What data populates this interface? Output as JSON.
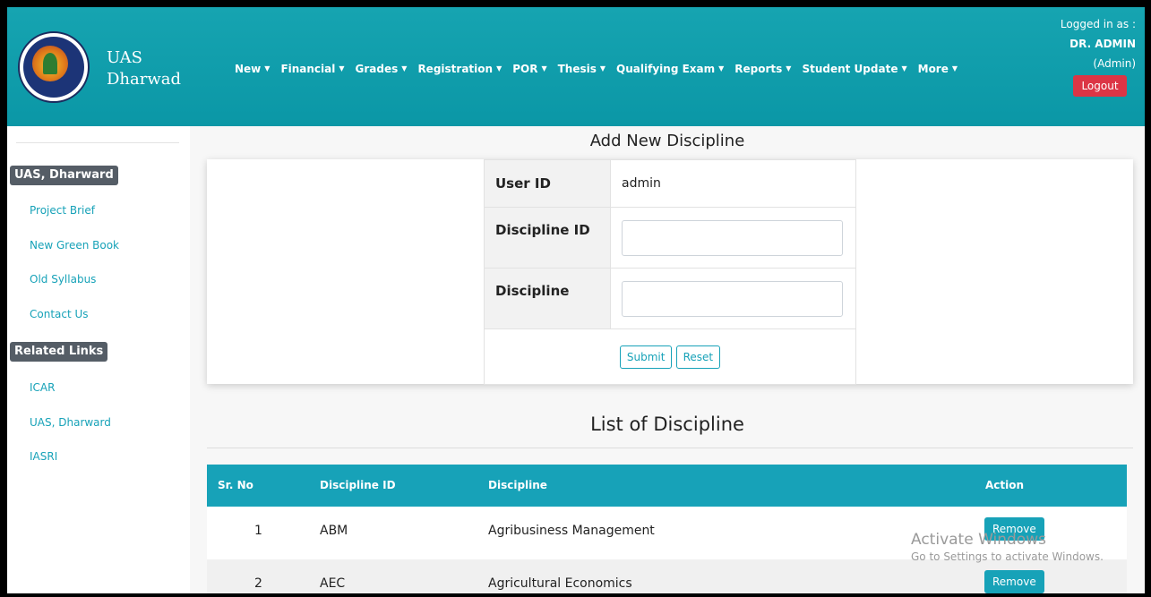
{
  "navbar": {
    "brand_line1": "UAS",
    "brand_line2": "Dharwad",
    "menu": [
      {
        "label": "New"
      },
      {
        "label": "Financial"
      },
      {
        "label": "Grades"
      },
      {
        "label": "Registration"
      },
      {
        "label": "POR"
      },
      {
        "label": "Thesis"
      },
      {
        "label": "Qualifying Exam"
      },
      {
        "label": "Reports"
      },
      {
        "label": "Student Update"
      },
      {
        "label": "More"
      }
    ],
    "logged_in_label": "Logged in as :",
    "user_name": "DR. ADMIN",
    "user_role": "(Admin)",
    "logout_label": "Logout"
  },
  "sidebar": {
    "section1_title": "UAS, Dharward",
    "section1_links": [
      "Project Brief",
      "New Green Book",
      "Old Syllabus",
      "Contact Us"
    ],
    "section2_title": "Related Links",
    "section2_links": [
      "ICAR",
      "UAS, Dharward",
      "IASRI"
    ]
  },
  "form": {
    "title": "Add New Discipline",
    "user_id_label": "User ID",
    "user_id_value": "admin",
    "discipline_id_label": "Discipline ID",
    "discipline_id_value": "",
    "discipline_label": "Discipline",
    "discipline_value": "",
    "submit_label": "Submit",
    "reset_label": "Reset"
  },
  "list": {
    "title": "List of Discipline",
    "columns": {
      "sr_no": "Sr. No",
      "discipline_id": "Discipline ID",
      "discipline": "Discipline",
      "action": "Action"
    },
    "rows": [
      {
        "sr_no": "1",
        "discipline_id": "ABM",
        "discipline": "Agribusiness Management",
        "action": "Remove"
      },
      {
        "sr_no": "2",
        "discipline_id": "AEC",
        "discipline": "Agricultural Economics",
        "action": "Remove"
      }
    ]
  },
  "watermark": {
    "line1": "Activate Windows",
    "line2": "Go to Settings to activate Windows."
  }
}
